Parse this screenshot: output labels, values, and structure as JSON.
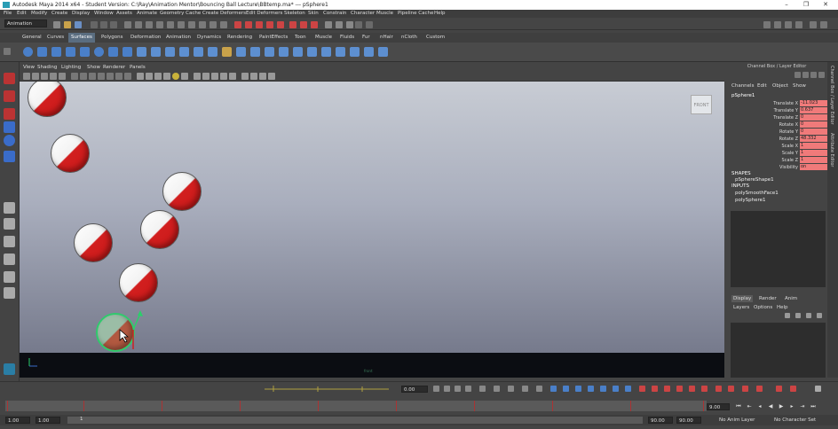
{
  "window": {
    "title": "Autodesk Maya 2014 x64 - Student Version: C:\\Ray\\Animation Mentor\\Bouncing Ball Lecture\\BBtemp.ma*   ---   pSphere1",
    "controls": [
      "–",
      "❐",
      "✕"
    ]
  },
  "menubar": [
    "File",
    "Edit",
    "Modify",
    "Create",
    "Display",
    "Window",
    "Assets",
    "Animate",
    "Geometry Cache",
    "Create Deformers",
    "Edit Deformers",
    "Skeleton",
    "Skin",
    "Constrain",
    "Character",
    "Muscle",
    "Pipeline Cache",
    "Help"
  ],
  "status": {
    "mode": "Animation"
  },
  "shelf_tabs": [
    "General",
    "Curves",
    "Surfaces",
    "Polygons",
    "Deformation",
    "Animation",
    "Dynamics",
    "Rendering",
    "PaintEffects",
    "Toon",
    "Muscle",
    "Fluids",
    "Fur",
    "nHair",
    "nCloth",
    "Custom"
  ],
  "shelf_active": "Surfaces",
  "panel_menu": [
    "View",
    "Shading",
    "Lighting",
    "Show",
    "Renderer",
    "Panels"
  ],
  "viewport": {
    "camera_label": "FRONT",
    "floor_label": "front"
  },
  "channel_box": {
    "title": "Channel Box / Layer Editor",
    "menu": [
      "Channels",
      "Edit",
      "Object",
      "Show"
    ],
    "object": "pSphere1",
    "attributes": [
      {
        "name": "Translate X",
        "value": "-11.023"
      },
      {
        "name": "Translate Y",
        "value": "0.637"
      },
      {
        "name": "Translate Z",
        "value": "0"
      },
      {
        "name": "Rotate X",
        "value": "0"
      },
      {
        "name": "Rotate Y",
        "value": "0"
      },
      {
        "name": "Rotate Z",
        "value": "48.332"
      },
      {
        "name": "Scale X",
        "value": "1"
      },
      {
        "name": "Scale Y",
        "value": "1"
      },
      {
        "name": "Scale Z",
        "value": "1"
      },
      {
        "name": "Visibility",
        "value": "on"
      }
    ],
    "shapes_label": "SHAPES",
    "shape": "pSphereShape1",
    "inputs_label": "INPUTS",
    "inputs": [
      "polySmoothFace1",
      "polySphere1"
    ]
  },
  "layer_editor": {
    "tabs": [
      "Display",
      "Render",
      "Anim"
    ],
    "active": "Display",
    "menu": [
      "Layers",
      "Options",
      "Help"
    ]
  },
  "side_tabs": [
    "Channel Box / Layer Editor",
    "Attribute Editor"
  ],
  "timeline": {
    "current_value": "0.00",
    "current_frame": "9.00",
    "range_start": "1.00",
    "range_start2": "1.00",
    "range_marker": "1",
    "range_end": "90.00",
    "range_end2": "90.00",
    "anim_layer": "No Anim Layer",
    "character_set": "No Character Set"
  },
  "colors": {
    "accent": "#5a6d80",
    "key_red": "#f07a7a",
    "ball_red": "#d21f1f",
    "select_green": "#2ad06a"
  }
}
